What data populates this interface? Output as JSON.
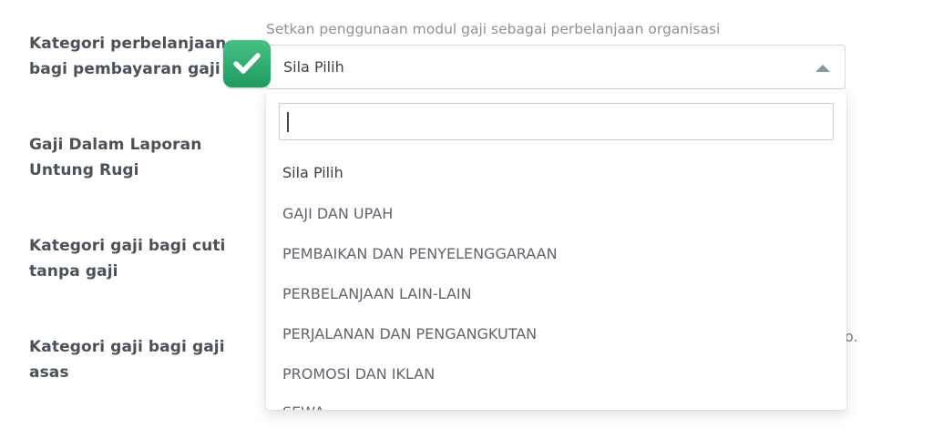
{
  "form": {
    "rows": [
      {
        "label_line1": "Kategori perbelanjaan",
        "label_line2": "bagi pembayaran gaji"
      },
      {
        "label_line1": "Gaji Dalam Laporan",
        "label_line2": "Untung Rugi"
      },
      {
        "label_line1": "Kategori gaji bagi cuti",
        "label_line2": "tanpa gaji"
      },
      {
        "label_line1": "Kategori gaji bagi gaji",
        "label_line2": "asas"
      }
    ],
    "help_text": "Setkan penggunaan modul gaji sebagai perbelanjaan organisasi",
    "select_value": "Sila Pilih",
    "stray_text": "o."
  },
  "dropdown": {
    "search_value": "",
    "options": [
      "Sila Pilih",
      "GAJI DAN UPAH",
      "PEMBAIKAN DAN PENYELENGGARAAN",
      "PERBELANJAAN LAIN-LAIN",
      "PERJALANAN DAN PENGANGKUTAN",
      "PROMOSI DAN IKLAN",
      "SEWA"
    ]
  },
  "icons": {
    "check": "check-icon",
    "caret": "caret-up-icon"
  },
  "colors": {
    "badge_green": "#2aa96b",
    "label_text": "#4b5159",
    "muted_text": "#8c9198"
  }
}
